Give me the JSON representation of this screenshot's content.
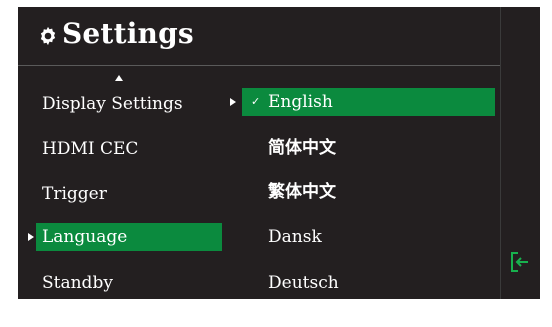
{
  "header": {
    "title": "Settings",
    "icon": "gear-icon"
  },
  "menu": {
    "items": [
      {
        "label": "Display Settings"
      },
      {
        "label": "HDMI CEC"
      },
      {
        "label": "Trigger"
      },
      {
        "label": "Language",
        "selected": true
      },
      {
        "label": "Standby"
      }
    ]
  },
  "language_options": {
    "items": [
      {
        "label": "English",
        "selected": true
      },
      {
        "label": "简体中文"
      },
      {
        "label": "繁体中文"
      },
      {
        "label": "Dansk"
      },
      {
        "label": "Deutsch"
      }
    ]
  },
  "colors": {
    "panel": "#231f20",
    "highlight": "#0b8a3e",
    "text": "#ffffff"
  },
  "side": {
    "icon": "exit-icon"
  }
}
